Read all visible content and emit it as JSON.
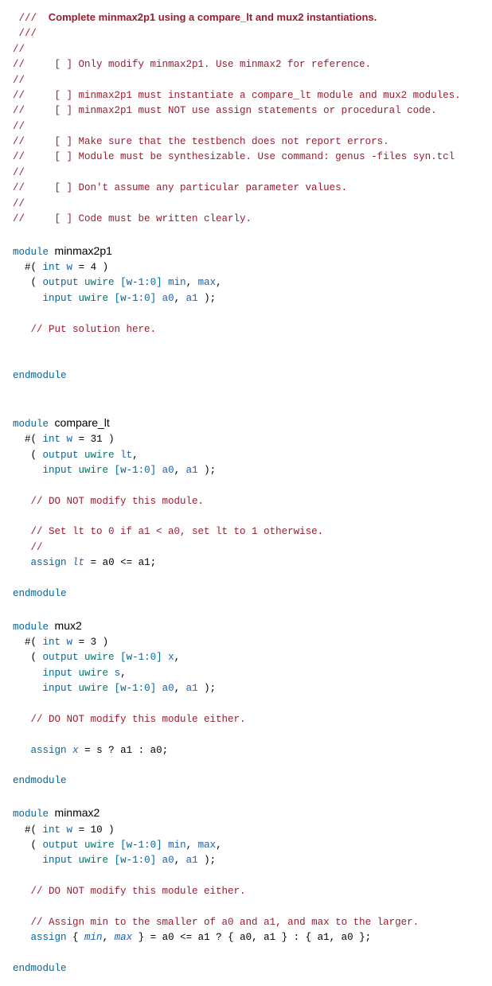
{
  "lines": [
    {
      "segs": [
        {
          "c": "cm",
          "t": " /// "
        },
        {
          "c": "cm-strong",
          "t": "  Complete minmax2p1 using a compare_lt and mux2 instantiations."
        }
      ]
    },
    {
      "segs": [
        {
          "c": "cm",
          "t": " ///"
        }
      ]
    },
    {
      "segs": [
        {
          "c": "cm",
          "t": "//"
        }
      ]
    },
    {
      "segs": [
        {
          "c": "cm",
          "t": "//     [ ] Only modify minmax2p1. Use minmax2 for reference."
        }
      ]
    },
    {
      "segs": [
        {
          "c": "cm",
          "t": "//"
        }
      ]
    },
    {
      "segs": [
        {
          "c": "cm",
          "t": "//     [ ] minmax2p1 must instantiate a compare_lt module and mux2 modules."
        }
      ]
    },
    {
      "segs": [
        {
          "c": "cm",
          "t": "//     [ ] minmax2p1 must NOT use assign statements or procedural code."
        }
      ]
    },
    {
      "segs": [
        {
          "c": "cm",
          "t": "//"
        }
      ]
    },
    {
      "segs": [
        {
          "c": "cm",
          "t": "//     [ ] Make sure that the testbench does not report errors."
        }
      ]
    },
    {
      "segs": [
        {
          "c": "cm",
          "t": "//     [ ] Module must be synthesizable. Use command: genus -files syn.tcl"
        }
      ]
    },
    {
      "segs": [
        {
          "c": "cm",
          "t": "//"
        }
      ]
    },
    {
      "segs": [
        {
          "c": "cm",
          "t": "//     [ ] Don't assume any particular parameter values."
        }
      ]
    },
    {
      "segs": [
        {
          "c": "cm",
          "t": "//"
        }
      ]
    },
    {
      "segs": [
        {
          "c": "cm",
          "t": "//     [ ] Code must be written clearly."
        }
      ]
    },
    {
      "segs": [
        {
          "c": "nm",
          "t": " "
        }
      ]
    },
    {
      "segs": [
        {
          "c": "kw",
          "t": "module"
        },
        {
          "c": "nm",
          "t": " "
        },
        {
          "c": "fn",
          "t": "minmax2p1"
        }
      ]
    },
    {
      "segs": [
        {
          "c": "nm",
          "t": "  #( "
        },
        {
          "c": "kw",
          "t": "int"
        },
        {
          "c": "nm",
          "t": " "
        },
        {
          "c": "id",
          "t": "w"
        },
        {
          "c": "nm",
          "t": " = 4 )"
        }
      ]
    },
    {
      "segs": [
        {
          "c": "nm",
          "t": "   ( "
        },
        {
          "c": "kw",
          "t": "output"
        },
        {
          "c": "nm",
          "t": " "
        },
        {
          "c": "ty",
          "t": "uwire"
        },
        {
          "c": "nm",
          "t": " "
        },
        {
          "c": "bus",
          "t": "[w-1:0]"
        },
        {
          "c": "nm",
          "t": " "
        },
        {
          "c": "id",
          "t": "min"
        },
        {
          "c": "nm",
          "t": ", "
        },
        {
          "c": "id",
          "t": "max"
        },
        {
          "c": "nm",
          "t": ","
        }
      ]
    },
    {
      "segs": [
        {
          "c": "nm",
          "t": "     "
        },
        {
          "c": "kw",
          "t": "input"
        },
        {
          "c": "nm",
          "t": " "
        },
        {
          "c": "ty",
          "t": "uwire"
        },
        {
          "c": "nm",
          "t": " "
        },
        {
          "c": "bus",
          "t": "[w-1:0]"
        },
        {
          "c": "nm",
          "t": " "
        },
        {
          "c": "id",
          "t": "a0"
        },
        {
          "c": "nm",
          "t": ", "
        },
        {
          "c": "id",
          "t": "a1"
        },
        {
          "c": "nm",
          "t": " );"
        }
      ]
    },
    {
      "segs": [
        {
          "c": "nm",
          "t": " "
        }
      ]
    },
    {
      "segs": [
        {
          "c": "nm",
          "t": "   "
        },
        {
          "c": "cm",
          "t": "// Put solution here."
        }
      ]
    },
    {
      "segs": [
        {
          "c": "nm",
          "t": " "
        }
      ]
    },
    {
      "segs": [
        {
          "c": "nm",
          "t": " "
        }
      ]
    },
    {
      "segs": [
        {
          "c": "kw",
          "t": "endmodule"
        }
      ]
    },
    {
      "segs": [
        {
          "c": "nm",
          "t": " "
        }
      ]
    },
    {
      "segs": [
        {
          "c": "nm",
          "t": " "
        }
      ]
    },
    {
      "segs": [
        {
          "c": "kw",
          "t": "module"
        },
        {
          "c": "nm",
          "t": " "
        },
        {
          "c": "fn",
          "t": "compare_lt"
        }
      ]
    },
    {
      "segs": [
        {
          "c": "nm",
          "t": "  #( "
        },
        {
          "c": "kw",
          "t": "int"
        },
        {
          "c": "nm",
          "t": " "
        },
        {
          "c": "id",
          "t": "w"
        },
        {
          "c": "nm",
          "t": " = 31 )"
        }
      ]
    },
    {
      "segs": [
        {
          "c": "nm",
          "t": "   ( "
        },
        {
          "c": "kw",
          "t": "output"
        },
        {
          "c": "nm",
          "t": " "
        },
        {
          "c": "ty",
          "t": "uwire"
        },
        {
          "c": "nm",
          "t": " "
        },
        {
          "c": "id",
          "t": "lt"
        },
        {
          "c": "nm",
          "t": ","
        }
      ]
    },
    {
      "segs": [
        {
          "c": "nm",
          "t": "     "
        },
        {
          "c": "kw",
          "t": "input"
        },
        {
          "c": "nm",
          "t": " "
        },
        {
          "c": "ty",
          "t": "uwire"
        },
        {
          "c": "nm",
          "t": " "
        },
        {
          "c": "bus",
          "t": "[w-1:0]"
        },
        {
          "c": "nm",
          "t": " "
        },
        {
          "c": "id",
          "t": "a0"
        },
        {
          "c": "nm",
          "t": ", "
        },
        {
          "c": "id",
          "t": "a1"
        },
        {
          "c": "nm",
          "t": " );"
        }
      ]
    },
    {
      "segs": [
        {
          "c": "nm",
          "t": " "
        }
      ]
    },
    {
      "segs": [
        {
          "c": "nm",
          "t": "   "
        },
        {
          "c": "cm",
          "t": "// DO NOT modify this module."
        }
      ]
    },
    {
      "segs": [
        {
          "c": "nm",
          "t": " "
        }
      ]
    },
    {
      "segs": [
        {
          "c": "nm",
          "t": "   "
        },
        {
          "c": "cm",
          "t": "// Set lt to 0 if a1 < a0, set lt to 1 otherwise."
        }
      ]
    },
    {
      "segs": [
        {
          "c": "nm",
          "t": "   "
        },
        {
          "c": "cm",
          "t": "//"
        }
      ]
    },
    {
      "segs": [
        {
          "c": "nm",
          "t": "   "
        },
        {
          "c": "kw",
          "t": "assign"
        },
        {
          "c": "nm",
          "t": " "
        },
        {
          "c": "id it",
          "t": "lt"
        },
        {
          "c": "nm",
          "t": " = a0 <= a1;"
        }
      ]
    },
    {
      "segs": [
        {
          "c": "nm",
          "t": " "
        }
      ]
    },
    {
      "segs": [
        {
          "c": "kw",
          "t": "endmodule"
        }
      ]
    },
    {
      "segs": [
        {
          "c": "nm",
          "t": " "
        }
      ]
    },
    {
      "segs": [
        {
          "c": "kw",
          "t": "module"
        },
        {
          "c": "nm",
          "t": " "
        },
        {
          "c": "fn",
          "t": "mux2"
        }
      ]
    },
    {
      "segs": [
        {
          "c": "nm",
          "t": "  #( "
        },
        {
          "c": "kw",
          "t": "int"
        },
        {
          "c": "nm",
          "t": " "
        },
        {
          "c": "id",
          "t": "w"
        },
        {
          "c": "nm",
          "t": " = 3 )"
        }
      ]
    },
    {
      "segs": [
        {
          "c": "nm",
          "t": "   ( "
        },
        {
          "c": "kw",
          "t": "output"
        },
        {
          "c": "nm",
          "t": " "
        },
        {
          "c": "ty",
          "t": "uwire"
        },
        {
          "c": "nm",
          "t": " "
        },
        {
          "c": "bus",
          "t": "[w-1:0]"
        },
        {
          "c": "nm",
          "t": " "
        },
        {
          "c": "id",
          "t": "x"
        },
        {
          "c": "nm",
          "t": ","
        }
      ]
    },
    {
      "segs": [
        {
          "c": "nm",
          "t": "     "
        },
        {
          "c": "kw",
          "t": "input"
        },
        {
          "c": "nm",
          "t": " "
        },
        {
          "c": "ty",
          "t": "uwire"
        },
        {
          "c": "nm",
          "t": " "
        },
        {
          "c": "id",
          "t": "s"
        },
        {
          "c": "nm",
          "t": ","
        }
      ]
    },
    {
      "segs": [
        {
          "c": "nm",
          "t": "     "
        },
        {
          "c": "kw",
          "t": "input"
        },
        {
          "c": "nm",
          "t": " "
        },
        {
          "c": "ty",
          "t": "uwire"
        },
        {
          "c": "nm",
          "t": " "
        },
        {
          "c": "bus",
          "t": "[w-1:0]"
        },
        {
          "c": "nm",
          "t": " "
        },
        {
          "c": "id",
          "t": "a0"
        },
        {
          "c": "nm",
          "t": ", "
        },
        {
          "c": "id",
          "t": "a1"
        },
        {
          "c": "nm",
          "t": " );"
        }
      ]
    },
    {
      "segs": [
        {
          "c": "nm",
          "t": " "
        }
      ]
    },
    {
      "segs": [
        {
          "c": "nm",
          "t": "   "
        },
        {
          "c": "cm",
          "t": "// DO NOT modify this module either."
        }
      ]
    },
    {
      "segs": [
        {
          "c": "nm",
          "t": " "
        }
      ]
    },
    {
      "segs": [
        {
          "c": "nm",
          "t": "   "
        },
        {
          "c": "kw",
          "t": "assign"
        },
        {
          "c": "nm",
          "t": " "
        },
        {
          "c": "id it",
          "t": "x"
        },
        {
          "c": "nm",
          "t": " = s ? a1 : a0;"
        }
      ]
    },
    {
      "segs": [
        {
          "c": "nm",
          "t": " "
        }
      ]
    },
    {
      "segs": [
        {
          "c": "kw",
          "t": "endmodule"
        }
      ]
    },
    {
      "segs": [
        {
          "c": "nm",
          "t": " "
        }
      ]
    },
    {
      "segs": [
        {
          "c": "kw",
          "t": "module"
        },
        {
          "c": "nm",
          "t": " "
        },
        {
          "c": "fn",
          "t": "minmax2"
        }
      ]
    },
    {
      "segs": [
        {
          "c": "nm",
          "t": "  #( "
        },
        {
          "c": "kw",
          "t": "int"
        },
        {
          "c": "nm",
          "t": " "
        },
        {
          "c": "id",
          "t": "w"
        },
        {
          "c": "nm",
          "t": " = 10 )"
        }
      ]
    },
    {
      "segs": [
        {
          "c": "nm",
          "t": "   ( "
        },
        {
          "c": "kw",
          "t": "output"
        },
        {
          "c": "nm",
          "t": " "
        },
        {
          "c": "ty",
          "t": "uwire"
        },
        {
          "c": "nm",
          "t": " "
        },
        {
          "c": "bus",
          "t": "[w-1:0]"
        },
        {
          "c": "nm",
          "t": " "
        },
        {
          "c": "id",
          "t": "min"
        },
        {
          "c": "nm",
          "t": ", "
        },
        {
          "c": "id",
          "t": "max"
        },
        {
          "c": "nm",
          "t": ","
        }
      ]
    },
    {
      "segs": [
        {
          "c": "nm",
          "t": "     "
        },
        {
          "c": "kw",
          "t": "input"
        },
        {
          "c": "nm",
          "t": " "
        },
        {
          "c": "ty",
          "t": "uwire"
        },
        {
          "c": "nm",
          "t": " "
        },
        {
          "c": "bus",
          "t": "[w-1:0]"
        },
        {
          "c": "nm",
          "t": " "
        },
        {
          "c": "id",
          "t": "a0"
        },
        {
          "c": "nm",
          "t": ", "
        },
        {
          "c": "id",
          "t": "a1"
        },
        {
          "c": "nm",
          "t": " );"
        }
      ]
    },
    {
      "segs": [
        {
          "c": "nm",
          "t": " "
        }
      ]
    },
    {
      "segs": [
        {
          "c": "nm",
          "t": "   "
        },
        {
          "c": "cm",
          "t": "// DO NOT modify this module either."
        }
      ]
    },
    {
      "segs": [
        {
          "c": "nm",
          "t": " "
        }
      ]
    },
    {
      "segs": [
        {
          "c": "nm",
          "t": "   "
        },
        {
          "c": "cm",
          "t": "// Assign min to the smaller of a0 and a1, and max to the larger."
        }
      ]
    },
    {
      "segs": [
        {
          "c": "nm",
          "t": "   "
        },
        {
          "c": "kw",
          "t": "assign"
        },
        {
          "c": "nm",
          "t": " { "
        },
        {
          "c": "id it",
          "t": "min"
        },
        {
          "c": "nm",
          "t": ", "
        },
        {
          "c": "id it",
          "t": "max"
        },
        {
          "c": "nm",
          "t": " } = a0 <= a1 ? { a0, a1 } : { a1, a0 };"
        }
      ]
    },
    {
      "segs": [
        {
          "c": "nm",
          "t": " "
        }
      ]
    },
    {
      "segs": [
        {
          "c": "kw",
          "t": "endmodule"
        }
      ]
    }
  ]
}
